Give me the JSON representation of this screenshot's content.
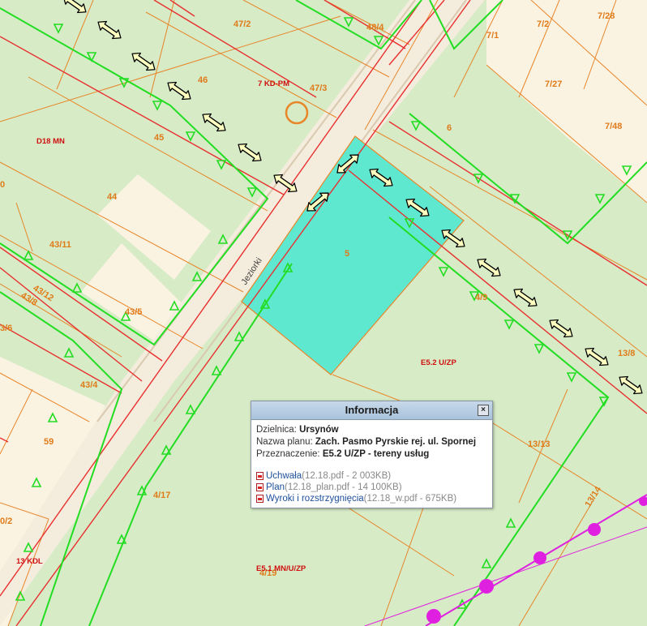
{
  "map": {
    "street_label": "Jeziorki",
    "zone_labels": [
      "7 KD-PM",
      "D18 MN",
      "E5.2 U/ZP",
      "E5.1 MN/U/ZP",
      "13 KDL"
    ],
    "parcel_labels": [
      "47/2",
      "48/4",
      "7/2",
      "7/28",
      "7/1",
      "46",
      "47/3",
      "7/27",
      "45",
      "6",
      "7/48",
      "0",
      "44",
      "43/11",
      "5",
      "43/12",
      "43/8",
      "43/5",
      "4/9",
      "3/6",
      "13/8",
      "43/4",
      "59",
      "13/13",
      "0/2",
      "4/17",
      "13/14",
      "4/19"
    ],
    "colors": {
      "background": "#d6ebc6",
      "selected_parcel": "#5fe8d0",
      "parcel_border": "#e8862a",
      "plan_line": "#e83030",
      "green_line": "#22dd22",
      "power_line": "#e020e0"
    }
  },
  "popup": {
    "title": "Informacja",
    "close_label": "×",
    "dzielnica_label": "Dzielnica: ",
    "dzielnica_value": "Ursynów",
    "plan_label": "Nazwa planu: ",
    "plan_value": "Zach. Pasmo Pyrskie rej. ul. Spornej",
    "przeznaczenie_label": "Przeznaczenie: ",
    "przeznaczenie_value": "E5.2 U/ZP - tereny usług",
    "files": [
      {
        "name": "Uchwała",
        "meta": "(12.18.pdf - 2 003KB)"
      },
      {
        "name": "Plan",
        "meta": "(12.18_plan.pdf - 14 100KB)"
      },
      {
        "name": "Wyroki i rozstrzygnięcia",
        "meta": "(12.18_w.pdf - 675KB)"
      }
    ]
  }
}
